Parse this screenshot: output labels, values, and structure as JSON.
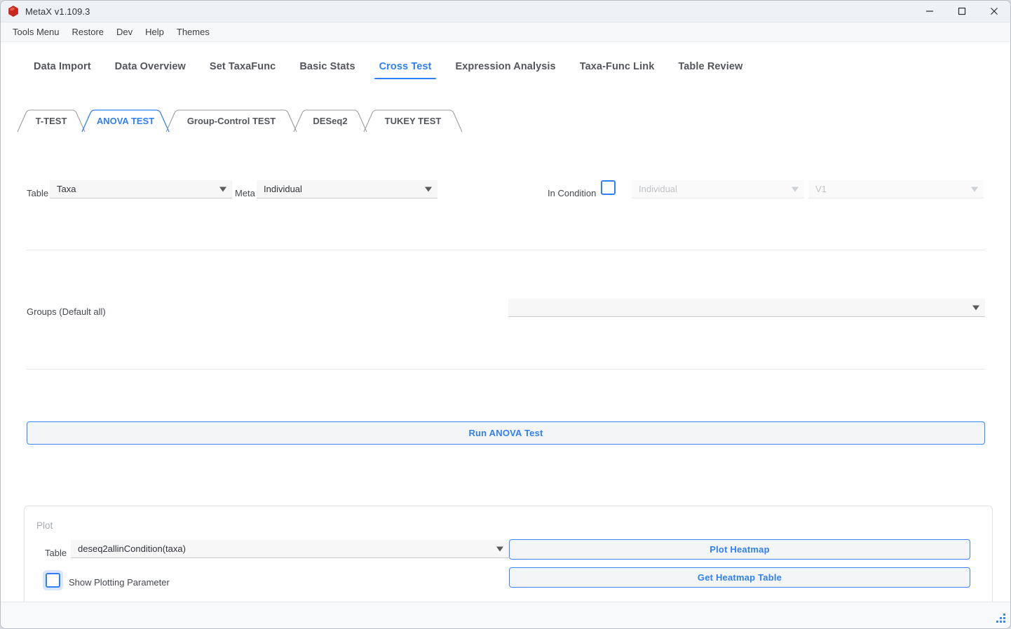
{
  "window": {
    "title": "MetaX v1.109.3",
    "app_icon": "hexagon-icon",
    "controls": {
      "minimize": "minimize-icon",
      "maximize": "maximize-icon",
      "close": "close-icon"
    }
  },
  "menubar": {
    "items": [
      "Tools Menu",
      "Restore",
      "Dev",
      "Help",
      "Themes"
    ]
  },
  "main_tabs": [
    {
      "label": "Data Import",
      "active": false
    },
    {
      "label": "Data Overview",
      "active": false
    },
    {
      "label": "Set TaxaFunc",
      "active": false
    },
    {
      "label": "Basic Stats",
      "active": false
    },
    {
      "label": "Cross Test",
      "active": true
    },
    {
      "label": "Expression Analysis",
      "active": false
    },
    {
      "label": "Taxa-Func Link",
      "active": false
    },
    {
      "label": "Table Review",
      "active": false
    }
  ],
  "sub_tabs": [
    {
      "label": "T-TEST",
      "active": false
    },
    {
      "label": "ANOVA TEST",
      "active": true
    },
    {
      "label": "Group-Control TEST",
      "active": false
    },
    {
      "label": "DESeq2",
      "active": false
    },
    {
      "label": "TUKEY TEST",
      "active": false
    }
  ],
  "form": {
    "table_label": "Table",
    "table_value": "Taxa",
    "meta_label": "Meta",
    "meta_value": "Individual",
    "in_condition_label": "In Condition",
    "in_condition_checked": false,
    "condition_meta_placeholder": "Individual",
    "condition_value_placeholder": "V1",
    "groups_label": "Groups (Default all)",
    "groups_value": ""
  },
  "run_button": {
    "label": "Run ANOVA Test"
  },
  "plot": {
    "title": "Plot",
    "table_label": "Table",
    "table_value": "deseq2allinCondition(taxa)",
    "show_param_label": "Show Plotting Parameter",
    "show_param_checked": false,
    "plot_heatmap_label": "Plot Heatmap",
    "get_heatmap_table_label": "Get Heatmap Table"
  },
  "colors": {
    "accent": "#2f80f5",
    "text": "#53565c",
    "muted": "#a7abb1",
    "icon_red": "#c9261d"
  }
}
